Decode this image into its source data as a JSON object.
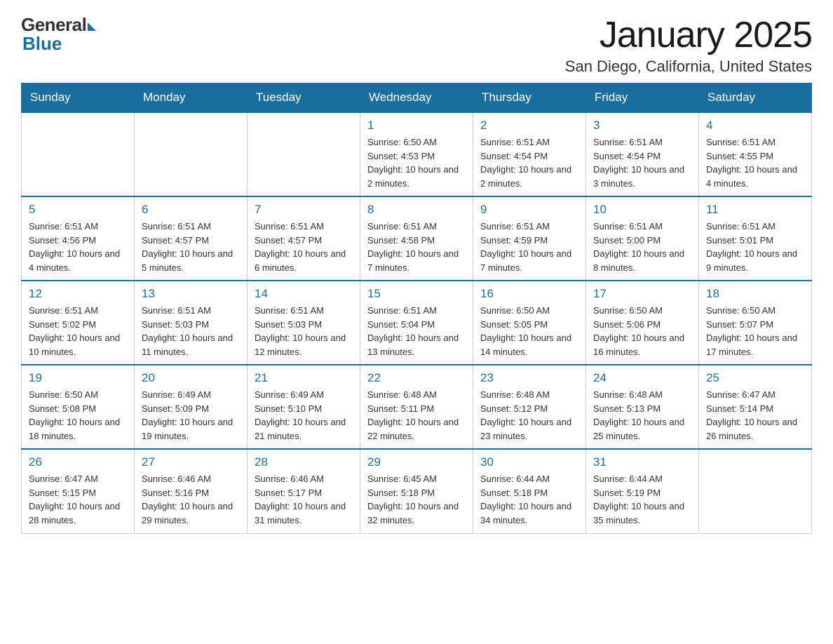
{
  "header": {
    "logo_general": "General",
    "logo_blue": "Blue",
    "month": "January 2025",
    "location": "San Diego, California, United States"
  },
  "days_of_week": [
    "Sunday",
    "Monday",
    "Tuesday",
    "Wednesday",
    "Thursday",
    "Friday",
    "Saturday"
  ],
  "weeks": [
    {
      "cells": [
        {
          "day": null,
          "info": null
        },
        {
          "day": null,
          "info": null
        },
        {
          "day": null,
          "info": null
        },
        {
          "day": "1",
          "info": "Sunrise: 6:50 AM\nSunset: 4:53 PM\nDaylight: 10 hours\nand 2 minutes."
        },
        {
          "day": "2",
          "info": "Sunrise: 6:51 AM\nSunset: 4:54 PM\nDaylight: 10 hours\nand 2 minutes."
        },
        {
          "day": "3",
          "info": "Sunrise: 6:51 AM\nSunset: 4:54 PM\nDaylight: 10 hours\nand 3 minutes."
        },
        {
          "day": "4",
          "info": "Sunrise: 6:51 AM\nSunset: 4:55 PM\nDaylight: 10 hours\nand 4 minutes."
        }
      ]
    },
    {
      "cells": [
        {
          "day": "5",
          "info": "Sunrise: 6:51 AM\nSunset: 4:56 PM\nDaylight: 10 hours\nand 4 minutes."
        },
        {
          "day": "6",
          "info": "Sunrise: 6:51 AM\nSunset: 4:57 PM\nDaylight: 10 hours\nand 5 minutes."
        },
        {
          "day": "7",
          "info": "Sunrise: 6:51 AM\nSunset: 4:57 PM\nDaylight: 10 hours\nand 6 minutes."
        },
        {
          "day": "8",
          "info": "Sunrise: 6:51 AM\nSunset: 4:58 PM\nDaylight: 10 hours\nand 7 minutes."
        },
        {
          "day": "9",
          "info": "Sunrise: 6:51 AM\nSunset: 4:59 PM\nDaylight: 10 hours\nand 7 minutes."
        },
        {
          "day": "10",
          "info": "Sunrise: 6:51 AM\nSunset: 5:00 PM\nDaylight: 10 hours\nand 8 minutes."
        },
        {
          "day": "11",
          "info": "Sunrise: 6:51 AM\nSunset: 5:01 PM\nDaylight: 10 hours\nand 9 minutes."
        }
      ]
    },
    {
      "cells": [
        {
          "day": "12",
          "info": "Sunrise: 6:51 AM\nSunset: 5:02 PM\nDaylight: 10 hours\nand 10 minutes."
        },
        {
          "day": "13",
          "info": "Sunrise: 6:51 AM\nSunset: 5:03 PM\nDaylight: 10 hours\nand 11 minutes."
        },
        {
          "day": "14",
          "info": "Sunrise: 6:51 AM\nSunset: 5:03 PM\nDaylight: 10 hours\nand 12 minutes."
        },
        {
          "day": "15",
          "info": "Sunrise: 6:51 AM\nSunset: 5:04 PM\nDaylight: 10 hours\nand 13 minutes."
        },
        {
          "day": "16",
          "info": "Sunrise: 6:50 AM\nSunset: 5:05 PM\nDaylight: 10 hours\nand 14 minutes."
        },
        {
          "day": "17",
          "info": "Sunrise: 6:50 AM\nSunset: 5:06 PM\nDaylight: 10 hours\nand 16 minutes."
        },
        {
          "day": "18",
          "info": "Sunrise: 6:50 AM\nSunset: 5:07 PM\nDaylight: 10 hours\nand 17 minutes."
        }
      ]
    },
    {
      "cells": [
        {
          "day": "19",
          "info": "Sunrise: 6:50 AM\nSunset: 5:08 PM\nDaylight: 10 hours\nand 18 minutes."
        },
        {
          "day": "20",
          "info": "Sunrise: 6:49 AM\nSunset: 5:09 PM\nDaylight: 10 hours\nand 19 minutes."
        },
        {
          "day": "21",
          "info": "Sunrise: 6:49 AM\nSunset: 5:10 PM\nDaylight: 10 hours\nand 21 minutes."
        },
        {
          "day": "22",
          "info": "Sunrise: 6:48 AM\nSunset: 5:11 PM\nDaylight: 10 hours\nand 22 minutes."
        },
        {
          "day": "23",
          "info": "Sunrise: 6:48 AM\nSunset: 5:12 PM\nDaylight: 10 hours\nand 23 minutes."
        },
        {
          "day": "24",
          "info": "Sunrise: 6:48 AM\nSunset: 5:13 PM\nDaylight: 10 hours\nand 25 minutes."
        },
        {
          "day": "25",
          "info": "Sunrise: 6:47 AM\nSunset: 5:14 PM\nDaylight: 10 hours\nand 26 minutes."
        }
      ]
    },
    {
      "cells": [
        {
          "day": "26",
          "info": "Sunrise: 6:47 AM\nSunset: 5:15 PM\nDaylight: 10 hours\nand 28 minutes."
        },
        {
          "day": "27",
          "info": "Sunrise: 6:46 AM\nSunset: 5:16 PM\nDaylight: 10 hours\nand 29 minutes."
        },
        {
          "day": "28",
          "info": "Sunrise: 6:46 AM\nSunset: 5:17 PM\nDaylight: 10 hours\nand 31 minutes."
        },
        {
          "day": "29",
          "info": "Sunrise: 6:45 AM\nSunset: 5:18 PM\nDaylight: 10 hours\nand 32 minutes."
        },
        {
          "day": "30",
          "info": "Sunrise: 6:44 AM\nSunset: 5:18 PM\nDaylight: 10 hours\nand 34 minutes."
        },
        {
          "day": "31",
          "info": "Sunrise: 6:44 AM\nSunset: 5:19 PM\nDaylight: 10 hours\nand 35 minutes."
        },
        {
          "day": null,
          "info": null
        }
      ]
    }
  ]
}
